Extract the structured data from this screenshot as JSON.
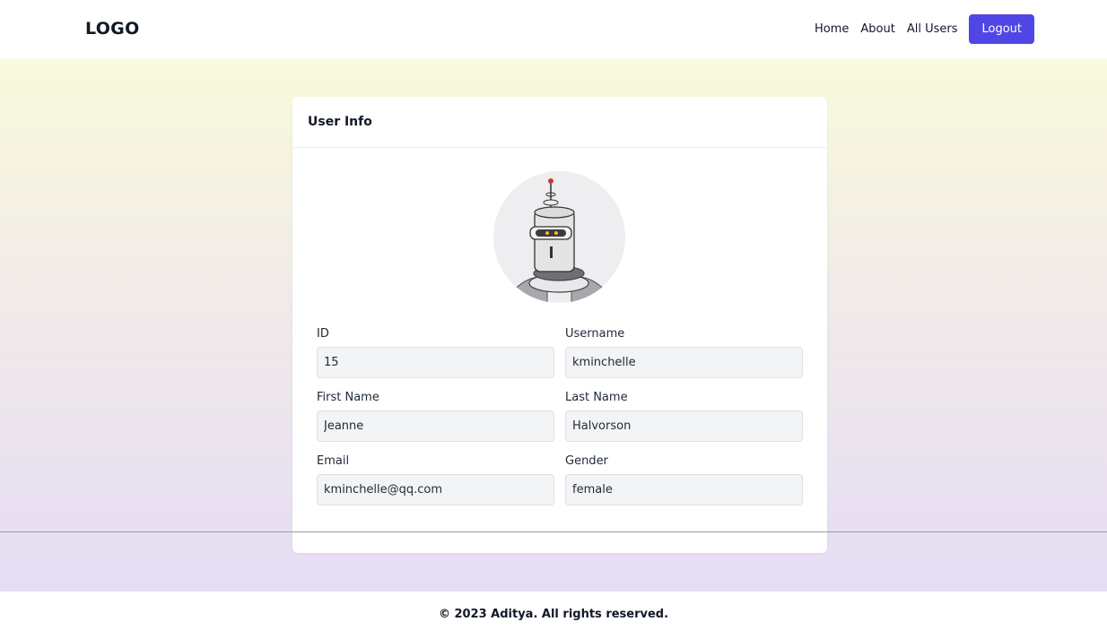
{
  "header": {
    "logo": "LOGO",
    "nav": [
      "Home",
      "About",
      "All Users"
    ],
    "logout_label": "Logout"
  },
  "card": {
    "title": "User Info",
    "avatar_icon": "robot-avatar-icon"
  },
  "fields": {
    "id": {
      "label": "ID",
      "value": "15"
    },
    "username": {
      "label": "Username",
      "value": "kminchelle"
    },
    "first_name": {
      "label": "First Name",
      "value": "Jeanne"
    },
    "last_name": {
      "label": "Last Name",
      "value": "Halvorson"
    },
    "email": {
      "label": "Email",
      "value": "kminchelle@qq.com"
    },
    "gender": {
      "label": "Gender",
      "value": "female"
    }
  },
  "footer": {
    "text": "© 2023 Aditya. All rights reserved."
  },
  "colors": {
    "accent": "#5046e5",
    "gradient_top": "#fafadc",
    "gradient_bottom": "#e6ddf5",
    "input_bg": "#f3f4f6"
  }
}
